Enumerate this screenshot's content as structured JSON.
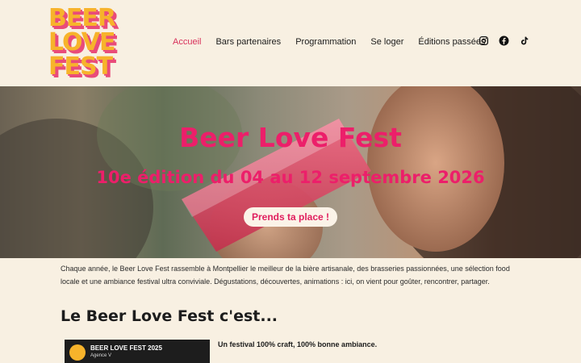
{
  "header": {
    "logo_lines": [
      "BEER",
      "LOVE",
      "FEST"
    ],
    "nav": [
      {
        "label": "Accueil",
        "active": true
      },
      {
        "label": "Bars partenaires",
        "active": false
      },
      {
        "label": "Programmation",
        "active": false
      },
      {
        "label": "Se loger",
        "active": false
      },
      {
        "label": "Éditions passées",
        "active": false
      }
    ],
    "socials": [
      "instagram-icon",
      "facebook-icon",
      "tiktok-icon"
    ]
  },
  "hero": {
    "title": "Beer Love Fest",
    "subtitle": "10e édition du 04 au 12 septembre 2026",
    "cta": "Prends ta place !"
  },
  "intro": "Chaque année, le Beer Love Fest rassemble à Montpellier le meilleur de la bière artisanale, des brasseries passionnées, une sélection food locale et une ambiance festival ultra conviviale. Dégustations, découvertes, animations : ici, on vient pour goûter, rencontrer, partager.",
  "section": {
    "title": "Le Beer Love Fest c'est...",
    "video_title": "BEER LOVE FEST 2025",
    "video_channel": "Agence V",
    "feature_text": "Un festival 100% craft, 100% bonne ambiance."
  },
  "colors": {
    "accent": "#ec1f6a",
    "nav_active": "#d8315b",
    "background": "#f8f0e2",
    "logo_yellow": "#f7b32b",
    "logo_pink": "#e94b7a"
  }
}
